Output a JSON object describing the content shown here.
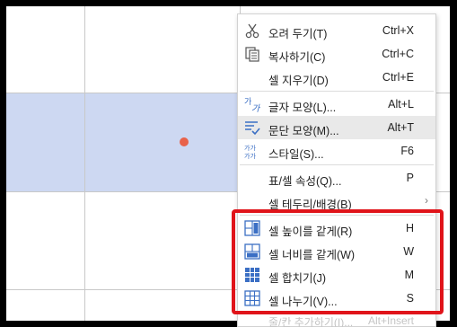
{
  "context_menu": {
    "items": [
      {
        "label": "오려 두기(T)",
        "shortcut": "Ctrl+X",
        "icon": "scissors-icon"
      },
      {
        "label": "복사하기(C)",
        "shortcut": "Ctrl+C",
        "icon": "copy-icon"
      },
      {
        "label": "셀 지우기(D)",
        "shortcut": "Ctrl+E",
        "icon": ""
      },
      {
        "label": "글자 모양(L)...",
        "shortcut": "Alt+L",
        "icon": "char-shape-icon"
      },
      {
        "label": "문단 모양(M)...",
        "shortcut": "Alt+T",
        "icon": "paragraph-shape-icon",
        "highlighted": true
      },
      {
        "label": "스타일(S)...",
        "shortcut": "F6",
        "icon": "style-icon"
      },
      {
        "label": "표/셀 속성(Q)...",
        "shortcut": "P",
        "icon": ""
      },
      {
        "label": "셀 테두리/배경(B)",
        "shortcut": "",
        "icon": "",
        "submenu": true
      },
      {
        "label": "셀 높이를 같게(R)",
        "shortcut": "H",
        "icon": "equal-height-icon"
      },
      {
        "label": "셀 너비를 같게(W)",
        "shortcut": "W",
        "icon": "equal-width-icon"
      },
      {
        "label": "셀 합치기(J)",
        "shortcut": "M",
        "icon": "merge-cells-icon"
      },
      {
        "label": "셀 나누기(V)...",
        "shortcut": "S",
        "icon": "split-cells-icon"
      }
    ],
    "cutoff_item": {
      "label": "줄/칸 추가하기(I)...",
      "shortcut": "Alt+Insert"
    },
    "icon_glyphs": {
      "char_shape": "가",
      "style": "가가"
    }
  },
  "colors": {
    "selection": "#cdd8f2",
    "highlight_box": "#e0141a",
    "cursor_dot": "#e8624a",
    "icon_blue": "#3b6fc4"
  }
}
